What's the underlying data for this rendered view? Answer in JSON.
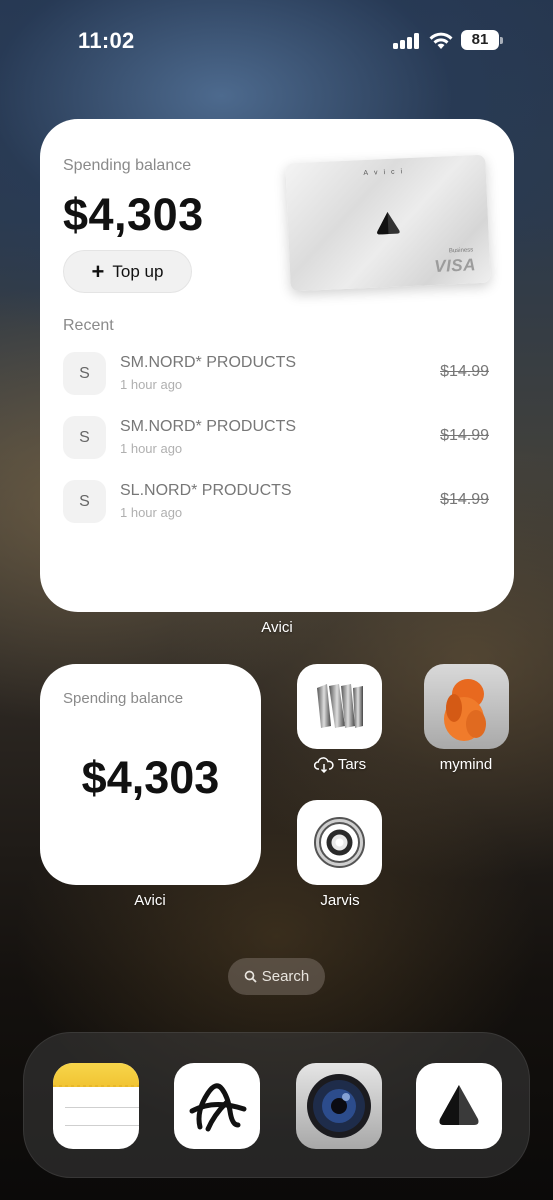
{
  "status_bar": {
    "time": "11:02",
    "battery": "81"
  },
  "avici_large": {
    "spending_label": "Spending balance",
    "balance": "$4,303",
    "topup_label": "Top up",
    "card": {
      "brand": "Avici",
      "business": "Business",
      "network": "VISA"
    },
    "recent_label": "Recent",
    "transactions": [
      {
        "avatar": "S",
        "name": "SM.NORD* PRODUCTS",
        "time": "1 hour ago",
        "amount": "$14.99"
      },
      {
        "avatar": "S",
        "name": "SM.NORD* PRODUCTS",
        "time": "1 hour ago",
        "amount": "$14.99"
      },
      {
        "avatar": "S",
        "name": "SL.NORD* PRODUCTS",
        "time": "1 hour ago",
        "amount": "$14.99"
      }
    ],
    "widget_label": "Avici"
  },
  "avici_small": {
    "spending_label": "Spending balance",
    "balance": "$4,303",
    "widget_label": "Avici"
  },
  "apps": {
    "tars": "Tars",
    "mymind": "mymind",
    "jarvis": "Jarvis"
  },
  "search": {
    "label": "Search"
  },
  "dock": [
    "notes-app-icon",
    "arc-app-icon",
    "camera-lens-app-icon",
    "avici-app-icon"
  ]
}
